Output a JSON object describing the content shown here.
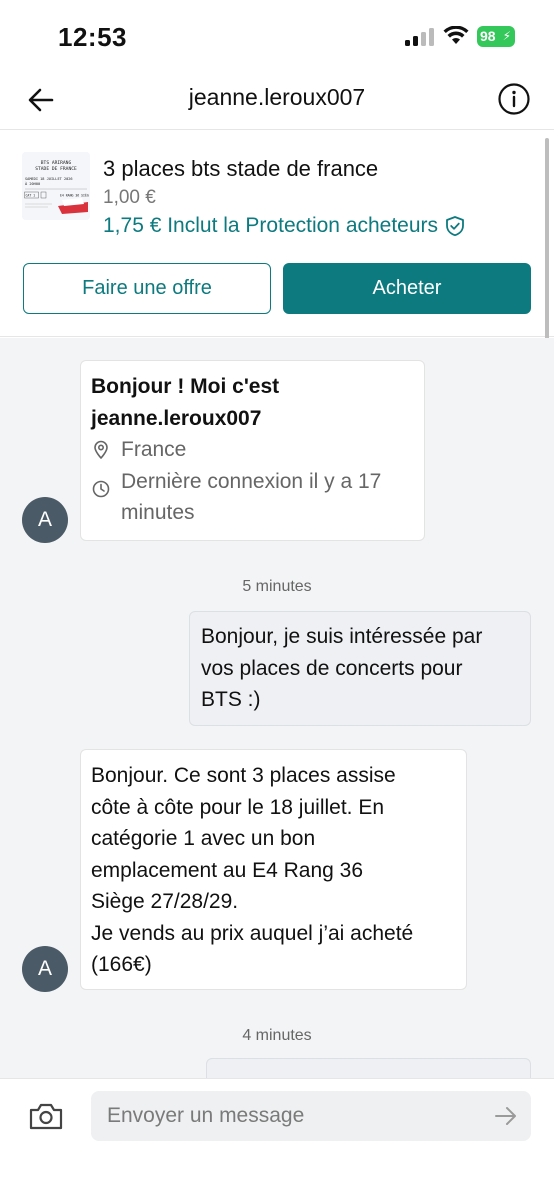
{
  "status_bar": {
    "time": "12:53",
    "battery": "98"
  },
  "header": {
    "title": "jeanne.leroux007"
  },
  "item": {
    "thumbnail_text": {
      "line1": "BTS ARIRANG",
      "line2": "STADE DE FRANCE",
      "line3": "SAMEDI 18 JUILLET 2026",
      "line4": "À 20H00",
      "cat": "CAT 1",
      "seat": "E4 RANG 36 SIÈG"
    },
    "title": "3 places bts stade de france",
    "price": "1,00 €",
    "protected_price": "1,75 € Inclut la Protection acheteurs"
  },
  "actions": {
    "offer_label": "Faire une offre",
    "buy_label": "Acheter"
  },
  "intro": {
    "greeting_line1": "Bonjour ! Moi c'est",
    "greeting_line2": "jeanne.leroux007",
    "location": "France",
    "last_seen_line1": "Dernière connexion il y a 17",
    "last_seen_line2": "minutes"
  },
  "messages": [
    {
      "timestamp": "5 minutes"
    },
    {
      "sender": "me",
      "lines": [
        "Bonjour, je suis intéressée par",
        "vos places de concerts pour",
        "BTS :)"
      ]
    },
    {
      "sender": "them",
      "avatar": "A",
      "lines": [
        "Bonjour. Ce sont 3 places assise",
        "côte à côte pour le 18 juillet. En",
        "catégorie 1 avec un bon",
        "emplacement au E4 Rang 36",
        "Siège 27/28/29.",
        "Je vends au prix auquel j’ai acheté",
        "(166€)"
      ]
    },
    {
      "timestamp": "4 minutes"
    }
  ],
  "avatar_letter": "A",
  "composer": {
    "placeholder": "Envoyer un message"
  },
  "colors": {
    "accent": "#0d7a7f",
    "battery": "#34c759",
    "avatar": "#4a5a66"
  },
  "icons": [
    "back-arrow-icon",
    "info-icon",
    "shield-check-icon",
    "location-pin-icon",
    "clock-icon",
    "camera-icon",
    "send-arrow-icon"
  ]
}
